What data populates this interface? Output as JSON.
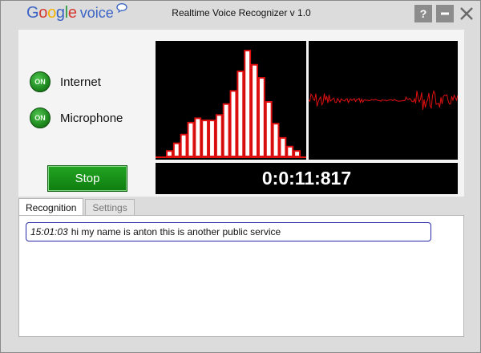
{
  "app": {
    "logo_google_letters": [
      {
        "ch": "G",
        "color": "#3a63c5"
      },
      {
        "ch": "o",
        "color": "#d63a2f"
      },
      {
        "ch": "o",
        "color": "#f2b400"
      },
      {
        "ch": "g",
        "color": "#3a63c5"
      },
      {
        "ch": "l",
        "color": "#2c9a3f"
      },
      {
        "ch": "e",
        "color": "#d63a2f"
      }
    ],
    "logo_voice": "voice",
    "title": "Realtime Voice Recognizer v 1.0",
    "help_label": "?"
  },
  "status": {
    "internet": {
      "led": "ON",
      "label": "Internet"
    },
    "microphone": {
      "led": "ON",
      "label": "Microphone"
    }
  },
  "controls": {
    "stop_label": "Stop"
  },
  "meters": {
    "histogram_levels": [
      0.05,
      0.12,
      0.2,
      0.31,
      0.35,
      0.33,
      0.33,
      0.38,
      0.48,
      0.6,
      0.78,
      0.97,
      0.84,
      0.72,
      0.5,
      0.3,
      0.17,
      0.09,
      0.05
    ],
    "bar_color": "#e01010",
    "bar_fill": "#ffffff",
    "waveform_color": "#e01010"
  },
  "timer": {
    "elapsed": "0:0:11:817"
  },
  "tabs": [
    {
      "label": "Recognition",
      "active": true
    },
    {
      "label": "Settings",
      "active": false
    }
  ],
  "results": [
    {
      "time": "15:01:03",
      "text": "hi my name is anton this is another public service"
    }
  ]
}
